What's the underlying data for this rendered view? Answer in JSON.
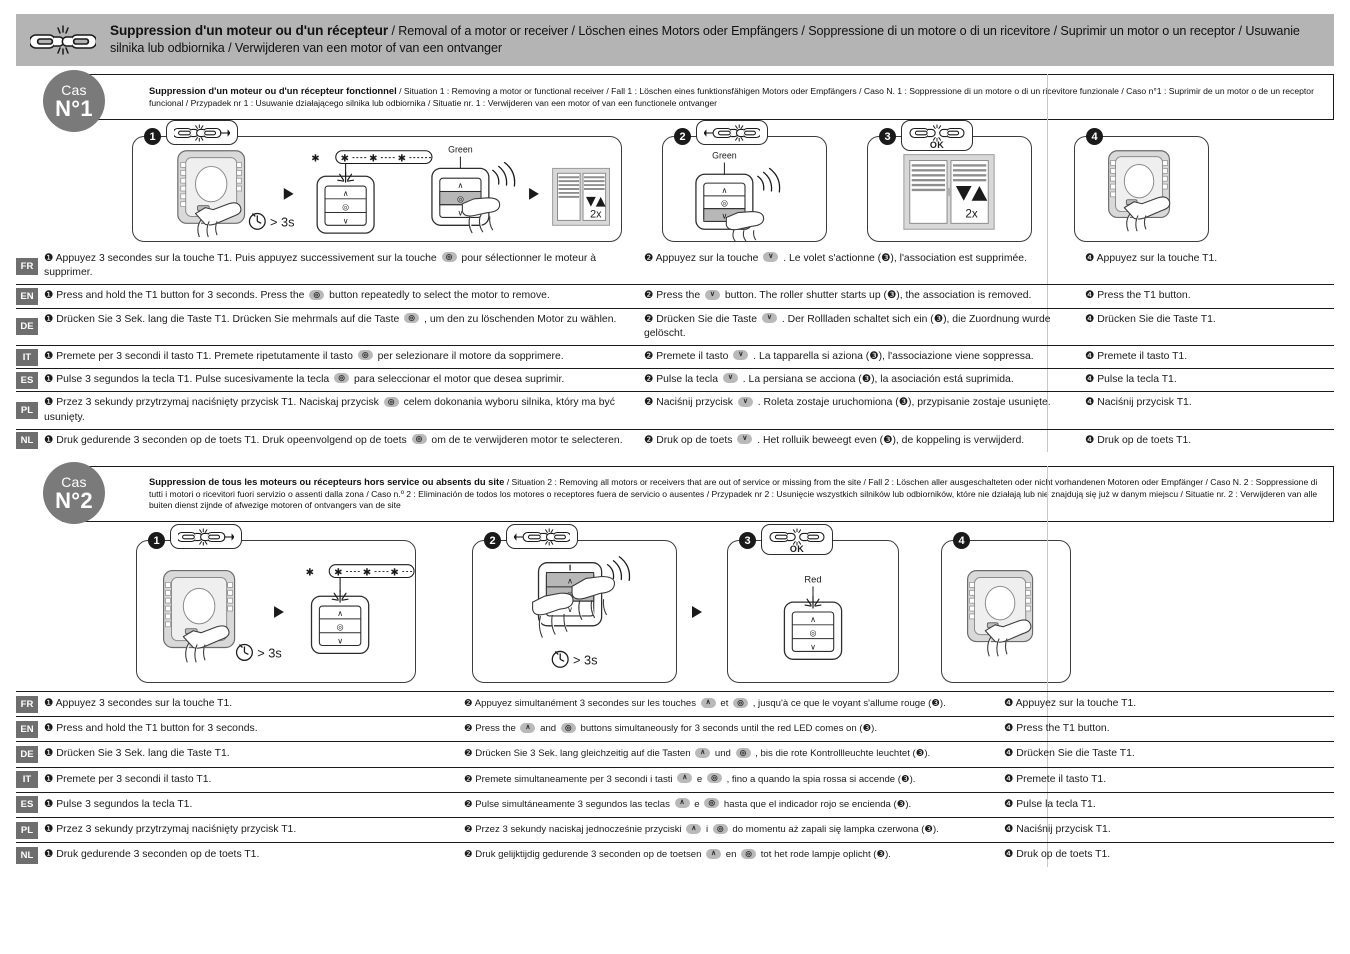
{
  "header": {
    "icon": "broken-chain-icon",
    "title_bold": "Suppression d'un moteur ou d'un récepteur",
    "title_rest": " / Removal of a motor or receiver / Löschen eines Motors oder Empfängers / Soppressione di un motore o di un ricevitore / Suprimir un motor o un receptor / Usuwanie silnika lub odbiornika / Verwijderen van een motor of van een ontvanger"
  },
  "case1": {
    "badge_cas": "Cas",
    "badge_num": "N°1",
    "desc_bold": "Suppression d'un moteur ou d'un récepteur fonctionnel",
    "desc_rest": " / Situation 1 : Removing a motor or functional receiver / Fall 1 : Löschen eines funktionsfähigen Motors oder Empfängers / Caso N. 1 : Soppressione di un motore o di un ricevitore funzionale / Caso n°1 : Suprimir de un motor o de un receptor funcional / Przypadek nr 1 : Usuwanie działającego silnika lub odbiornika / Situatie nr. 1 : Verwijderen van een motor of van een functionele ontvanger",
    "panels": {
      "p1": {
        "step": "1",
        "hold_time": "> 3s",
        "led_label": "Green",
        "shutter_count": "2x"
      },
      "p2": {
        "step": "2",
        "led_label": "Green"
      },
      "p3": {
        "step": "3",
        "ok": "OK",
        "shutter_count": "2x"
      },
      "p4": {
        "step": "4"
      }
    },
    "rows": [
      {
        "lang": "FR",
        "col1": [
          "❶ Appuyez 3 secondes sur la touche T1. Puis appuyez successivement sur la touche ",
          "stop",
          " pour sélectionner le moteur à supprimer."
        ],
        "col2": [
          "❷ Appuyez sur la touche ",
          "down",
          " . Le volet s'actionne (❸), l'association est supprimée."
        ],
        "col3": "❹ Appuyez sur la touche T1."
      },
      {
        "lang": "EN",
        "col1": [
          "❶ Press and hold the T1 button for 3 seconds. Press the ",
          "stop",
          " button repeatedly to select the motor to remove."
        ],
        "col2": [
          "❷ Press the ",
          "down",
          " button. The roller shutter starts up (❸), the association is removed."
        ],
        "col3": "❹ Press the T1 button."
      },
      {
        "lang": "DE",
        "col1": [
          "❶ Drücken Sie 3 Sek. lang die Taste T1. Drücken Sie mehrmals auf die Taste ",
          "stop",
          " , um den zu löschenden Motor zu wählen."
        ],
        "col2": [
          "❷ Drücken Sie die Taste ",
          "down",
          " . Der Rollladen schaltet sich ein (❸), die Zuordnung wurde gelöscht."
        ],
        "col3": "❹ Drücken Sie die Taste T1."
      },
      {
        "lang": "IT",
        "col1": [
          "❶ Premete per 3 secondi il tasto T1. Premete ripetutamente il tasto ",
          "stop",
          " per selezionare il motore da sopprimere."
        ],
        "col2": [
          "❷ Premete il tasto ",
          "down",
          " . La tapparella si aziona (❸), l'associazione viene soppressa."
        ],
        "col3": "❹ Premete il tasto T1."
      },
      {
        "lang": "ES",
        "col1": [
          "❶ Pulse 3 segundos la tecla T1. Pulse sucesivamente la tecla ",
          "stop",
          " para seleccionar el motor que desea suprimir."
        ],
        "col2": [
          "❷ Pulse la tecla ",
          "down",
          " . La persiana se acciona (❸), la asociación está suprimida."
        ],
        "col3": "❹ Pulse la tecla T1."
      },
      {
        "lang": "PL",
        "col1": [
          "❶ Przez 3 sekundy przytrzymaj naciśnięty przycisk T1. Naciskaj przycisk ",
          "stop",
          " celem dokonania wyboru silnika, który ma być usunięty."
        ],
        "col2": [
          "❷ Naciśnij przycisk ",
          "down",
          " . Roleta zostaje uruchomiona (❸), przypisanie zostaje usunięte."
        ],
        "col3": "❹ Naciśnij przycisk T1."
      },
      {
        "lang": "NL",
        "col1": [
          "❶ Druk gedurende 3 seconden op de toets T1. Druk opeenvolgend op de toets ",
          "stop",
          " om de te verwijderen motor te selecteren."
        ],
        "col2": [
          "❷ Druk op de toets ",
          "down",
          " . Het rolluik beweegt even (❸), de koppeling is verwijderd."
        ],
        "col3": "❹ Druk op de toets T1."
      }
    ]
  },
  "case2": {
    "badge_cas": "Cas",
    "badge_num": "N°2",
    "desc_bold": "Suppression de tous les moteurs ou récepteurs hors service ou absents du site",
    "desc_rest": " / Situation 2 : Removing all motors or receivers that are out of service or missing from the site / Fall 2 : Löschen aller ausgeschalteten oder nicht vorhandenen Motoren oder Empfänger / Caso N. 2 : Soppressione di tutti i motori o ricevitori fuori servizio o assenti dalla zona / Caso n.º 2 : Eliminación de todos los motores o receptores fuera de servicio o ausentes / Przypadek nr 2 : Usunięcie wszystkich silników lub odbiorników, które nie działają lub nie znajdują się już w danym miejscu / Situatie nr. 2 : Verwijderen van alle buiten dienst zijnde of afwezige motoren of ontvangers van de site",
    "panels": {
      "p1": {
        "step": "1",
        "hold_time": "> 3s"
      },
      "p2": {
        "step": "2",
        "hold_time": "> 3s"
      },
      "p3": {
        "step": "3",
        "ok": "OK",
        "led_label": "Red"
      },
      "p4": {
        "step": "4"
      }
    },
    "rows": [
      {
        "lang": "FR",
        "col1": [
          "❶ Appuyez 3 secondes sur la touche T1."
        ],
        "col2": [
          "❷ Appuyez simultanément 3 secondes sur les touches ",
          "up",
          " et ",
          "stop",
          " , jusqu'à ce que le voyant s'allume rouge (❸)."
        ],
        "col3": "❹ Appuyez sur la touche T1."
      },
      {
        "lang": "EN",
        "col1": [
          "❶ Press and hold the T1 button for 3 seconds."
        ],
        "col2": [
          "❷ Press the ",
          "up",
          " and ",
          "stop",
          " buttons simultaneously for 3 seconds until the red LED comes on (❸)."
        ],
        "col3": "❹ Press the T1 button."
      },
      {
        "lang": "DE",
        "col1": [
          "❶ Drücken Sie 3 Sek. lang die Taste T1."
        ],
        "col2": [
          "❷ Drücken Sie 3 Sek. lang gleichzeitig auf die Tasten ",
          "up",
          " und ",
          "stop",
          " , bis die rote Kontrollleuchte leuchtet (❸)."
        ],
        "col3": "❹ Drücken Sie die Taste T1."
      },
      {
        "lang": "IT",
        "col1": [
          "❶ Premete per 3 secondi il tasto T1."
        ],
        "col2": [
          "❷ Premete simultaneamente per 3 secondi i tasti ",
          "up",
          " e ",
          "stop",
          " , fino a quando la spia rossa si accende (❸)."
        ],
        "col3": "❹ Premete il tasto T1."
      },
      {
        "lang": "ES",
        "col1": [
          "❶ Pulse 3 segundos la tecla T1."
        ],
        "col2": [
          "❷ Pulse simultáneamente 3 segundos las teclas ",
          "up",
          " e ",
          "stop",
          " hasta que el indicador rojo se encienda (❸)."
        ],
        "col3": "❹ Pulse la tecla T1."
      },
      {
        "lang": "PL",
        "col1": [
          "❶ Przez 3 sekundy przytrzymaj naciśnięty przycisk T1."
        ],
        "col2": [
          "❷ Przez 3 sekundy naciskaj jednocześnie przyciski ",
          "up",
          " i ",
          "stop",
          " do momentu aż zapali się lampka czerwona (❸)."
        ],
        "col3": "❹ Naciśnij przycisk T1."
      },
      {
        "lang": "NL",
        "col1": [
          "❶ Druk gedurende 3 seconden op de toets T1."
        ],
        "col2": [
          "❷ Druk gelijktijdig gedurende 3 seconden op de toetsen ",
          "up",
          " en ",
          "stop",
          " tot het rode lampje oplicht (❸)."
        ],
        "col3": "❹ Druk op de toets T1."
      }
    ]
  },
  "colors": {
    "header_bg": "#b4b4b4",
    "badge_bg": "#7a7a7a",
    "lang_tag_bg": "#6e6e6e",
    "key_bg": "#b9b9b9",
    "ink": "#1a1a1a"
  }
}
